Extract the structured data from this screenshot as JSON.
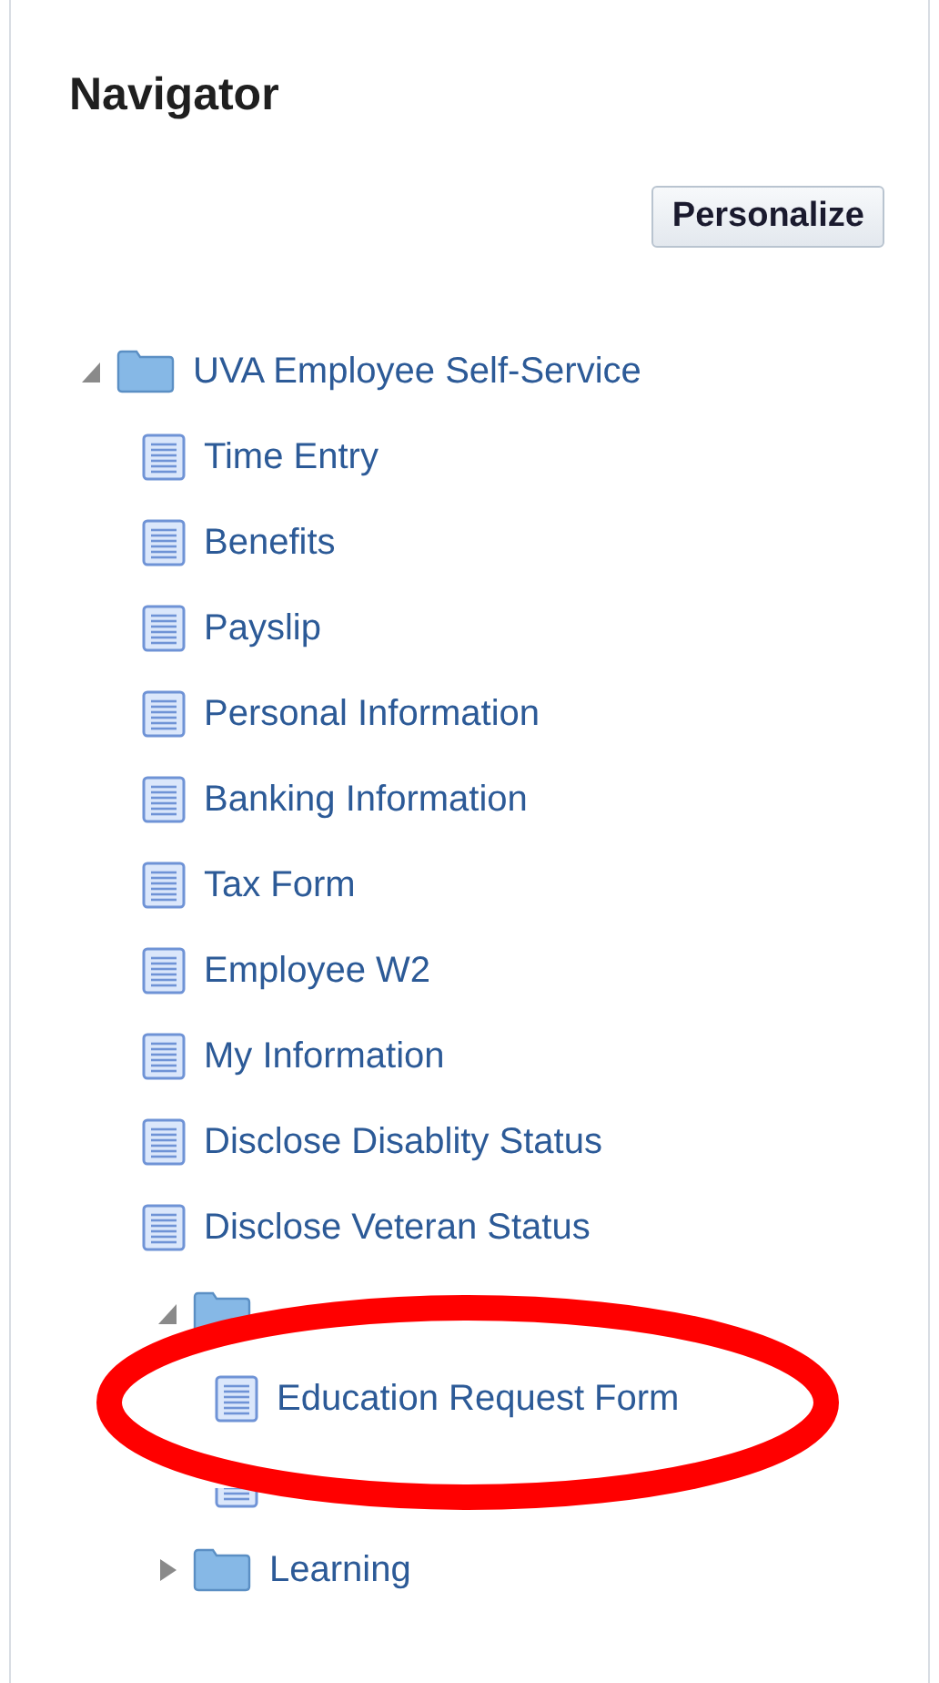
{
  "title": "Navigator",
  "personalize_button": "Personalize",
  "tree": [
    {
      "kind": "folder",
      "label": "UVA Employee Self-Service",
      "expanded": true,
      "children": [
        {
          "kind": "page",
          "label": "Time Entry"
        },
        {
          "kind": "page",
          "label": "Benefits"
        },
        {
          "kind": "page",
          "label": "Payslip"
        },
        {
          "kind": "page",
          "label": "Personal Information"
        },
        {
          "kind": "page",
          "label": "Banking Information"
        },
        {
          "kind": "page",
          "label": "Tax Form"
        },
        {
          "kind": "page",
          "label": "Employee W2"
        },
        {
          "kind": "page",
          "label": "My Information"
        },
        {
          "kind": "page",
          "label": "Disclose Disablity Status"
        },
        {
          "kind": "page",
          "label": "Disclose Veteran Status"
        },
        {
          "kind": "folder",
          "expanded": true,
          "children": [
            {
              "kind": "page",
              "label": "Education Request Form"
            },
            {
              "kind": "page"
            }
          ]
        },
        {
          "kind": "folder",
          "label": "Learning",
          "expanded": false
        }
      ]
    }
  ],
  "annotation": {
    "kind": "ellipse"
  }
}
